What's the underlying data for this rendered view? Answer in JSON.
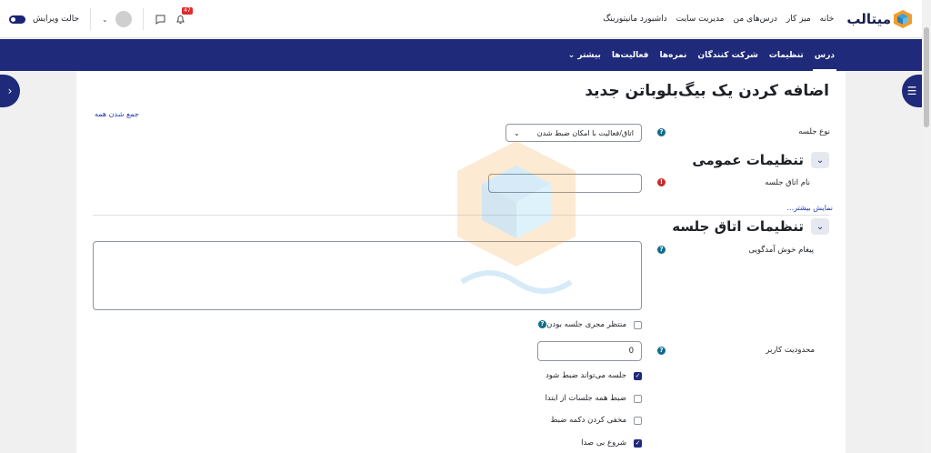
{
  "topbar": {
    "logo_text": "میتالب",
    "nav": [
      "خانه",
      "میز کار",
      "درس‌های من",
      "مدیریت سایت",
      "داشبورد مانیتورینگ"
    ],
    "notification_count": "47",
    "edit_mode_label": "حالت ویرایش"
  },
  "secondary_nav": {
    "tabs": [
      "درس",
      "تنظیمات",
      "شرکت کنندگان",
      "نمره‌ها",
      "فعالیت‌ها",
      "بیشتر"
    ]
  },
  "page": {
    "title": "اضافه کردن یک بیگ‌بلوباتن جدید",
    "collapse_all": "جمع شدن همه"
  },
  "form": {
    "session_type_label": "نوع جلسه",
    "session_type_value": "اتاق/فعالیت با امکان ضبط شدن",
    "general_section": "تنظیمات عمومی",
    "room_name_label": "نام اتاق جلسه",
    "room_name_value": "",
    "show_more": "نمایش بیشتر...",
    "room_section": "تنظیمات اتاق جلسه",
    "welcome_label": "پیغام خوش آمدگویی",
    "wait_moderator": "منتظر مجری جلسه بودن",
    "user_limit_label": "محدودیت کاربر",
    "user_limit_value": "0",
    "checkboxes": [
      {
        "label": "جلسه می‌تواند ضبط شود",
        "checked": true
      },
      {
        "label": "ضبط همه جلسات از ابتدا",
        "checked": false
      },
      {
        "label": "مخفی کردن دکمه ضبط",
        "checked": false
      },
      {
        "label": "شروع بی صدا",
        "checked": true
      }
    ]
  },
  "colors": {
    "primary": "#1f2a7a",
    "help": "#0f6c8c",
    "required": "#c62b2b"
  }
}
